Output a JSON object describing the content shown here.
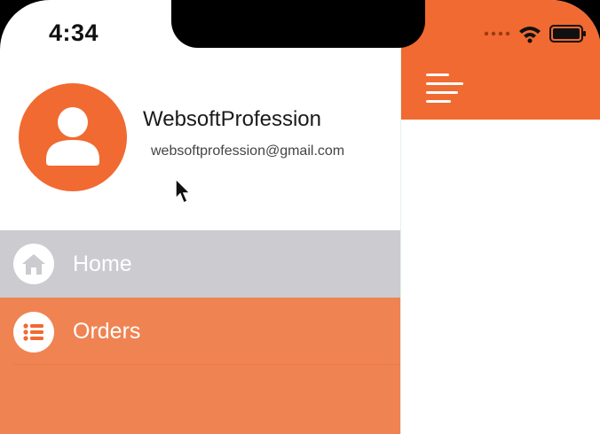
{
  "status_bar": {
    "time": "4:34"
  },
  "drawer": {
    "profile": {
      "name": "WebsoftProfession",
      "email": "websoftprofession@gmail.com"
    },
    "menu": [
      {
        "label": "Home",
        "icon": "home-icon",
        "selected": true
      },
      {
        "label": "Orders",
        "icon": "list-icon",
        "selected": false
      }
    ]
  },
  "colors": {
    "accent": "#f06a31",
    "accent_light": "#f08352",
    "selected_item": "#cbcbd0",
    "white": "#ffffff"
  },
  "main": {
    "menu_icon": "hamburger-menu-icon"
  }
}
